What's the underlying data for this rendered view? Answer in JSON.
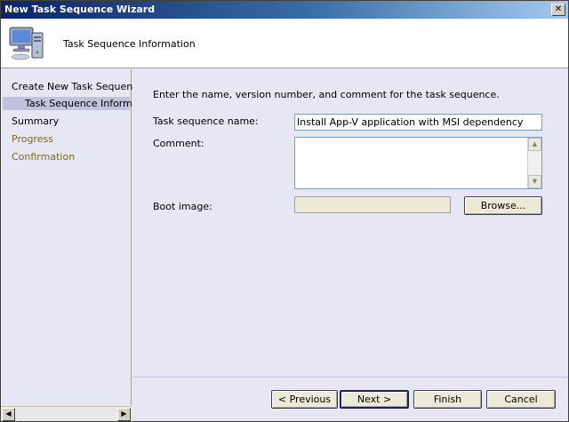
{
  "window": {
    "title": "New Task Sequence Wizard",
    "close_glyph": "✕"
  },
  "header": {
    "title": "Task Sequence Information",
    "icon": "computer-icon"
  },
  "sidebar": {
    "items": [
      {
        "label": "Create New Task Sequence",
        "state": "done"
      },
      {
        "label": "Task Sequence Information",
        "state": "current"
      },
      {
        "label": "Summary",
        "state": "done"
      },
      {
        "label": "Progress",
        "state": "pending"
      },
      {
        "label": "Confirmation",
        "state": "pending"
      }
    ]
  },
  "main": {
    "instruction": "Enter the name, version number, and comment for the task sequence.",
    "name_label": "Task sequence name:",
    "name_value": "Install App-V application with MSI dependency",
    "comment_label": "Comment:",
    "comment_value": "",
    "boot_label": "Boot image:",
    "boot_value": "",
    "browse_label": "Browse..."
  },
  "footer": {
    "previous_label": "< Previous",
    "next_label": "Next >",
    "finish_label": "Finish",
    "cancel_label": "Cancel"
  },
  "colors": {
    "title_gradient_start": "#0a246a",
    "panel_background": "#e6e6f5",
    "current_step_highlight": "#c2c2dc",
    "pending_step_text": "#7a6a20"
  }
}
